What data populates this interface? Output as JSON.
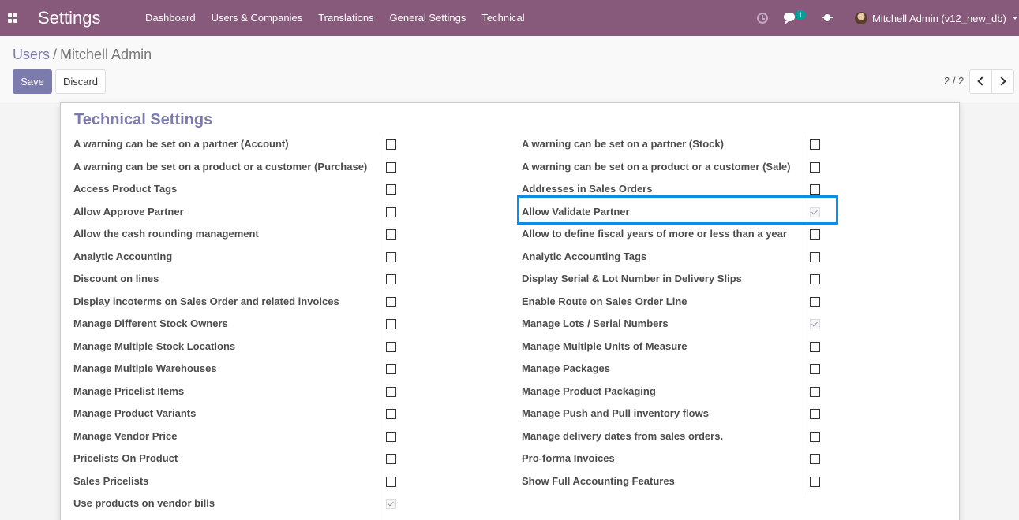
{
  "navbar": {
    "brand": "Settings",
    "menu": [
      "Dashboard",
      "Users & Companies",
      "Translations",
      "General Settings",
      "Technical"
    ],
    "chat_count": "1",
    "user_name": "Mitchell Admin (v12_new_db)"
  },
  "breadcrumb": {
    "parent": "Users",
    "separator": "/",
    "current": "Mitchell Admin"
  },
  "buttons": {
    "save": "Save",
    "discard": "Discard"
  },
  "pager": {
    "value": "2 / 2"
  },
  "section": {
    "title": "Technical Settings",
    "left": [
      {
        "label": "A warning can be set on a partner (Account)",
        "checked": false
      },
      {
        "label": "A warning can be set on a product or a customer (Purchase)",
        "checked": false
      },
      {
        "label": "Access Product Tags",
        "checked": false
      },
      {
        "label": "Allow Approve Partner",
        "checked": false
      },
      {
        "label": "Allow the cash rounding management",
        "checked": false
      },
      {
        "label": "Analytic Accounting",
        "checked": false
      },
      {
        "label": "Discount on lines",
        "checked": false
      },
      {
        "label": "Display incoterms on Sales Order and related invoices",
        "checked": false
      },
      {
        "label": "Manage Different Stock Owners",
        "checked": false
      },
      {
        "label": "Manage Multiple Stock Locations",
        "checked": false
      },
      {
        "label": "Manage Multiple Warehouses",
        "checked": false
      },
      {
        "label": "Manage Pricelist Items",
        "checked": false
      },
      {
        "label": "Manage Product Variants",
        "checked": false
      },
      {
        "label": "Manage Vendor Price",
        "checked": false
      },
      {
        "label": "Pricelists On Product",
        "checked": false
      },
      {
        "label": "Sales Pricelists",
        "checked": false
      },
      {
        "label": "Use products on vendor bills",
        "checked": true
      }
    ],
    "right": [
      {
        "label": "A warning can be set on a partner (Stock)",
        "checked": false
      },
      {
        "label": "A warning can be set on a product or a customer (Sale)",
        "checked": false
      },
      {
        "label": "Addresses in Sales Orders",
        "checked": false
      },
      {
        "label": "Allow Validate Partner",
        "checked": true
      },
      {
        "label": "Allow to define fiscal years of more or less than a year",
        "checked": false
      },
      {
        "label": "Analytic Accounting Tags",
        "checked": false
      },
      {
        "label": "Display Serial & Lot Number in Delivery Slips",
        "checked": false
      },
      {
        "label": "Enable Route on Sales Order Line",
        "checked": false
      },
      {
        "label": "Manage Lots / Serial Numbers",
        "checked": true
      },
      {
        "label": "Manage Multiple Units of Measure",
        "checked": false
      },
      {
        "label": "Manage Packages",
        "checked": false
      },
      {
        "label": "Manage Product Packaging",
        "checked": false
      },
      {
        "label": "Manage Push and Pull inventory flows",
        "checked": false
      },
      {
        "label": "Manage delivery dates from sales orders.",
        "checked": false
      },
      {
        "label": "Pro-forma Invoices",
        "checked": false
      },
      {
        "label": "Show Full Accounting Features",
        "checked": false
      }
    ]
  },
  "colors": {
    "navbar": "#875a7b",
    "accent": "#7c7bad",
    "highlight": "#0a8fe8",
    "badge": "#00a09d"
  }
}
